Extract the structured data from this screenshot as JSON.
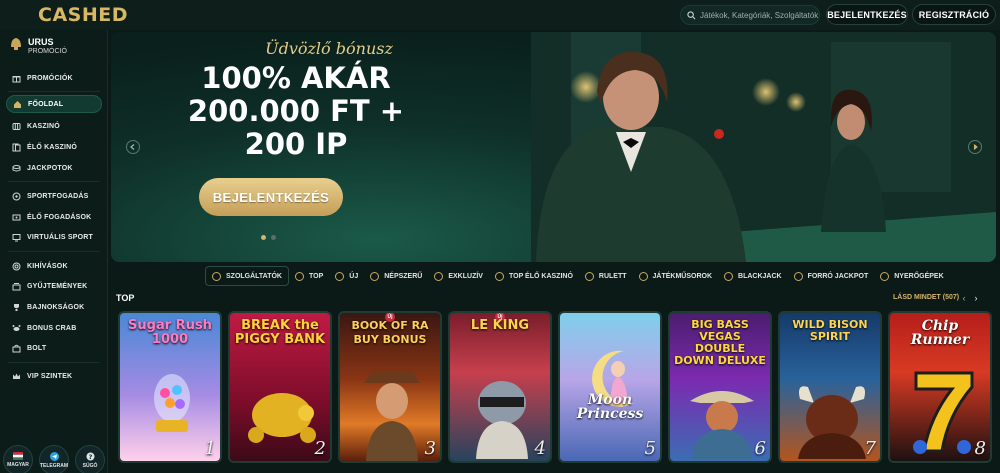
{
  "header": {
    "logo": "CASHED",
    "search_placeholder": "Játékok, Kategóriák, Szolgáltatók",
    "login_label": "BEJELENTKEZÉS",
    "register_label": "REGISZTRÁCIÓ"
  },
  "sidebar": {
    "rank_title": "URUS",
    "rank_sub": "PROMÓCIÓ",
    "items": [
      {
        "label": "PROMÓCIÓK",
        "icon": "gift-icon"
      },
      {
        "label": "FŐOLDAL",
        "icon": "home-icon",
        "active": true
      },
      {
        "label": "KASZINÓ",
        "icon": "slot-icon"
      },
      {
        "label": "ÉLŐ KASZINÓ",
        "icon": "cards-icon"
      },
      {
        "label": "JACKPOTOK",
        "icon": "coins-icon"
      },
      {
        "label": "SPORTFOGADÁS",
        "icon": "ball-icon"
      },
      {
        "label": "ÉLŐ FOGADÁSOK",
        "icon": "live-icon"
      },
      {
        "label": "VIRTUÁLIS SPORT",
        "icon": "monitor-icon"
      },
      {
        "label": "KIHÍVÁSOK",
        "icon": "target-icon"
      },
      {
        "label": "GYŰJTEMÉNYEK",
        "icon": "stack-icon"
      },
      {
        "label": "BAJNOKSÁGOK",
        "icon": "trophy-icon"
      },
      {
        "label": "BONUS CRAB",
        "icon": "crab-icon"
      },
      {
        "label": "BOLT",
        "icon": "shop-icon"
      },
      {
        "label": "VIP SZINTEK",
        "icon": "crown-icon"
      }
    ],
    "footer": [
      {
        "label": "MAGYAR",
        "icon": "flag-hu-icon"
      },
      {
        "label": "TELEGRAM",
        "icon": "telegram-icon"
      },
      {
        "label": "SÚGÓ",
        "icon": "help-icon"
      }
    ]
  },
  "banner": {
    "welcome": "Üdvözlő bónusz",
    "headline_1": "100% AKÁR",
    "headline_2": "200.000 FT +",
    "headline_3": "200 IP",
    "cta_label": "BEJELENTKEZÉS"
  },
  "categories": [
    {
      "label": "SZOLGÁLTATÓK",
      "boxed": true
    },
    {
      "label": "TOP"
    },
    {
      "label": "ÚJ"
    },
    {
      "label": "NÉPSZERŰ"
    },
    {
      "label": "EXKLUZÍV"
    },
    {
      "label": "TOP ÉLŐ KASZINÓ"
    },
    {
      "label": "RULETT"
    },
    {
      "label": "JÁTÉKMŰSOROK"
    },
    {
      "label": "BLACKJACK"
    },
    {
      "label": "FORRÓ JACKPOT"
    },
    {
      "label": "NYERŐGÉPEK"
    }
  ],
  "top_section": {
    "title": "TOP",
    "see_all": "LÁSD MINDET (507)",
    "new_badge": "Új",
    "games": [
      {
        "title": "Sugar Rush 1000",
        "rank": "1"
      },
      {
        "title": "BREAK the PIGGY BANK",
        "rank": "2"
      },
      {
        "title": "BOOK OF RA BUY BONUS",
        "rank": "3"
      },
      {
        "title": "LE KING",
        "rank": "4"
      },
      {
        "title": "Moon Princess",
        "rank": "5"
      },
      {
        "title": "BIG BASS VEGAS DOUBLE DOWN DELUXE",
        "rank": "6"
      },
      {
        "title": "WILD BISON SPIRIT",
        "rank": "7"
      },
      {
        "title": "Chip Runner",
        "rank": "8"
      }
    ]
  },
  "colors": {
    "accent": "#d5b368",
    "background": "#0b1a17",
    "active": "#123a30"
  }
}
